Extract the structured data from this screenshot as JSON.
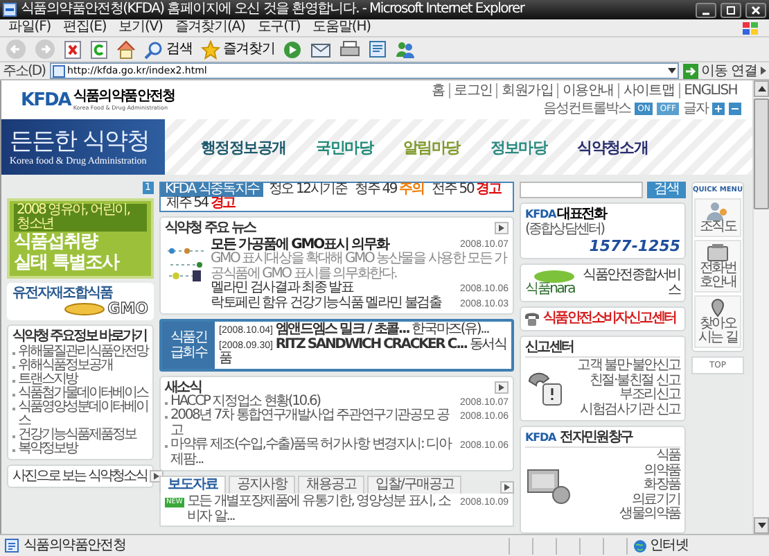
{
  "window": {
    "title": "식품의약품안전청(KFDA) 홈페이지에 오신 것을 환영합니다. - Microsoft Internet Explorer"
  },
  "menu": [
    "파일(F)",
    "편집(E)",
    "보기(V)",
    "즐겨찾기(A)",
    "도구(T)",
    "도움말(H)"
  ],
  "toolbar": {
    "search": "검색",
    "favorites": "즐겨찾기"
  },
  "address_bar": {
    "label": "주소(D)",
    "url": "http://kfda.go.kr/index2.html",
    "go": "이동",
    "links": "연결"
  },
  "header": {
    "logo_mark": "KFDA",
    "logo_text": "식품의약품안전청",
    "logo_sub": "Korea Food & Drug Administration",
    "top_links": [
      "홈",
      "로그인",
      "회원가입",
      "이용안내",
      "사이트맵",
      "ENGLISH"
    ],
    "voice": {
      "label": "음성컨트롤박스",
      "on": "ON",
      "off": "OFF",
      "font_label": "글자"
    }
  },
  "banner": {
    "title": "든든한 식약청",
    "subtitle": "Korea food & Drug Administration"
  },
  "nav": [
    {
      "label": "행정정보공개",
      "color": "#1f5a6e"
    },
    {
      "label": "국민마당",
      "color": "#1f8a78"
    },
    {
      "label": "알림마당",
      "color": "#7f9a2a"
    },
    {
      "label": "정보마당",
      "color": "#2a8a80"
    },
    {
      "label": "식약청소개",
      "color": "#2a2f6e"
    }
  ],
  "left": {
    "page_badge": "1",
    "promo": {
      "tag": "2008 영유아, 어린이, 청소년",
      "lines": [
        "식품섭취량",
        "실태 특별조사"
      ]
    },
    "gmo": {
      "title": "유전자재조합식품",
      "logo": "GMO"
    },
    "quick_links": {
      "title": "식약청 주요정보 바로가기",
      "items": [
        "위해물질관리식품안전망",
        "위해식품정보공개",
        "트랜스지방",
        "식품첨가물데이터베이스",
        "식품영양성분데이터베이스",
        "건강기능식품제품정보",
        "복약정보방"
      ]
    },
    "photo_news": {
      "title": "사진으로 보는 식약청소식"
    }
  },
  "food_poisoning_index": {
    "label": "KFDA 식중독지수",
    "time": "정오 12시기준",
    "regions": [
      {
        "name": "청주",
        "value": "49",
        "alert": "주의",
        "kind": "caution"
      },
      {
        "name": "전주",
        "value": "50",
        "alert": "경고",
        "kind": "warning"
      },
      {
        "name": "제주",
        "value": "54",
        "alert": "경고",
        "kind": "warning"
      }
    ]
  },
  "main_news": {
    "title": "식약청 주요 뉴스",
    "headline": {
      "title": "모든 가공품에 GMO표시 의무화",
      "date": "2008.10.07",
      "summary": "GMO 표시대상을 확대해 GMO 농산물을 사용한 모든 가공식품에 GMO 표시를 의무화한다."
    },
    "items": [
      {
        "title": "멜라민 검사결과 최종 발표",
        "date": "2008.10.06"
      },
      {
        "title": "락토페린 함유 건강기능식품 멜라민 불검출",
        "date": "2008.10.03"
      }
    ]
  },
  "recall": {
    "label": "식품긴급회수",
    "items": [
      {
        "date": "[2008.10.04]",
        "product": "엠앤드엠스 밀크 / 초콜...",
        "company": "한국마즈(유)..."
      },
      {
        "date": "[2008.09.30]",
        "product": "RITZ SANDWICH CRACKER C...",
        "company": "동서식품"
      }
    ]
  },
  "notices": {
    "title": "새소식",
    "items": [
      {
        "title": "HACCP 지정업소 현황(10.6)",
        "date": "2008.10.07"
      },
      {
        "title": "2008년 7차 통합연구개발사업 주관연구기관공모 공고",
        "date": "2008.10.06"
      },
      {
        "title": "마약류 제조(수입,수출)품목 허가사항 변경지시: 디아제팜...",
        "date": "2008.10.06"
      }
    ]
  },
  "press": {
    "tabs": [
      {
        "label": "보도자료",
        "selected": true
      },
      {
        "label": "공지사항",
        "selected": false
      },
      {
        "label": "채용공고",
        "selected": false
      },
      {
        "label": "입찰/구매공고",
        "selected": false
      }
    ],
    "items": [
      {
        "badge": "NEW",
        "title": "모든 개별포장제품에 유통기한, 영양성분 표시, 소비자 알...",
        "date": "2008.10.09"
      }
    ]
  },
  "right": {
    "search_button": "검색",
    "hotline": {
      "logo": "KFDA",
      "title": "대표전화",
      "subtitle": "(종합상담센터)",
      "number": "1577-1255"
    },
    "food_service": {
      "logo": "식품nara",
      "title": "식품안전종합서비스"
    },
    "report_banner": {
      "title": "식품안전소비자신고센터"
    },
    "report_center": {
      "title": "신고센터",
      "items": [
        "고객 불만·불안신고",
        "친절·불친절 신고",
        "부조리신고",
        "시험검사기관 신고"
      ]
    },
    "e_petition": {
      "logo": "KFDA",
      "title": "전자민원창구",
      "items": [
        "식품",
        "의약품",
        "화장품",
        "의료기기",
        "생물의약품"
      ]
    }
  },
  "quick_menu": {
    "title": "QUICK MENU",
    "items": [
      {
        "label": "조직도",
        "kind": "people"
      },
      {
        "label": "전화번호안내",
        "kind": "phone"
      },
      {
        "label": "찾아오시는 길",
        "kind": "map"
      }
    ],
    "top": "TOP"
  },
  "status_bar": {
    "text": "식품의약품안전청",
    "zone": "인터넷"
  }
}
